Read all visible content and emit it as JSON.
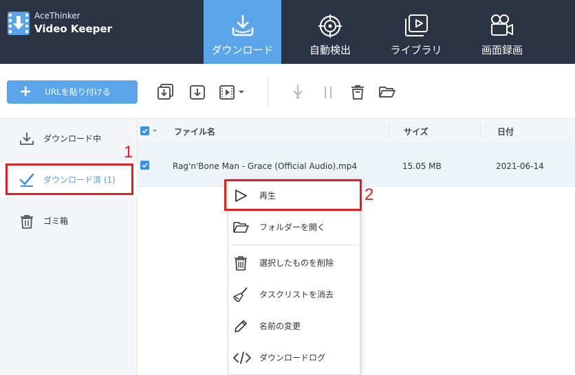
{
  "app": {
    "brand_line1": "AceThinker",
    "brand_line2": "Video Keeper"
  },
  "nav": {
    "tabs": [
      {
        "label": "ダウンロード",
        "icon": "download-tray-icon",
        "active": true
      },
      {
        "label": "自動検出",
        "icon": "target-icon",
        "active": false
      },
      {
        "label": "ライブラリ",
        "icon": "library-play-icon",
        "active": false
      },
      {
        "label": "画面録画",
        "icon": "camera-icon",
        "active": false
      }
    ]
  },
  "toolbar": {
    "paste_label": "URLを貼り付ける",
    "icons": [
      "download-batch-icon",
      "download-icon",
      "video-convert-icon",
      "resume-icon",
      "pause-icon",
      "delete-icon",
      "open-folder-icon"
    ]
  },
  "sidebar": {
    "items": [
      {
        "label": "ダウンロード中",
        "icon": "downloading-icon"
      },
      {
        "label": "ダウンロード済 (1)",
        "icon": "check-icon"
      },
      {
        "label": "ゴミ箱",
        "icon": "trash-icon"
      }
    ]
  },
  "table": {
    "headers": {
      "name": "ファイル名",
      "size": "サイズ",
      "date": "日付"
    },
    "rows": [
      {
        "name": "Rag'n'Bone Man - Grace (Official Audio).mp4",
        "size": "15.05 MB",
        "date": "2021-06-14"
      }
    ]
  },
  "context_menu": {
    "items": [
      {
        "label": "再生",
        "icon": "play-icon"
      },
      {
        "label": "フォルダーを開く",
        "icon": "folder-icon"
      },
      {
        "label": "選択したものを削除",
        "icon": "delete-icon"
      },
      {
        "label": "タスクリストを消去",
        "icon": "broom-icon"
      },
      {
        "label": "名前の変更",
        "icon": "pencil-icon"
      },
      {
        "label": "ダウンロードログ",
        "icon": "code-icon"
      }
    ]
  },
  "annotations": {
    "marker1": "1",
    "marker2": "2"
  },
  "colors": {
    "header_bg": "#2b3345",
    "accent": "#5aa5ea",
    "highlight": "#e02020"
  }
}
